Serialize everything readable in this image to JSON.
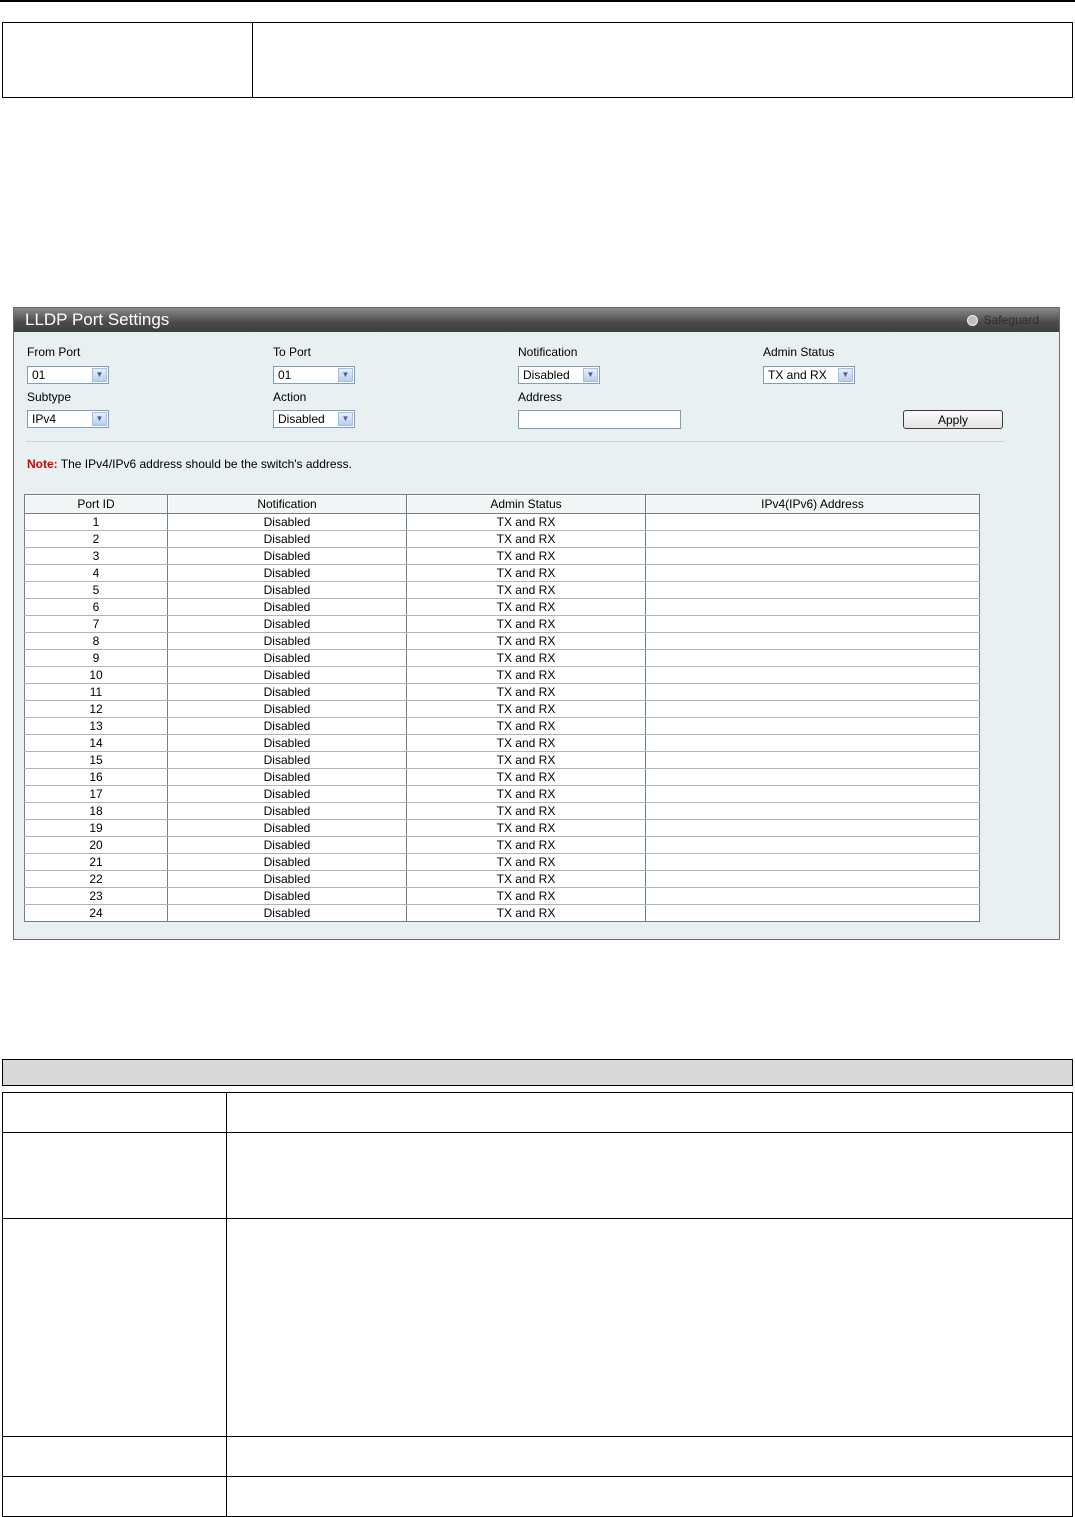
{
  "panel": {
    "title": "LLDP Port Settings",
    "safeguard": "Safeguard"
  },
  "form": {
    "from_port": {
      "label": "From Port",
      "value": "01"
    },
    "to_port": {
      "label": "To Port",
      "value": "01"
    },
    "notification": {
      "label": "Notification",
      "value": "Disabled"
    },
    "admin_status": {
      "label": "Admin Status",
      "value": "TX and RX"
    },
    "subtype": {
      "label": "Subtype",
      "value": "IPv4"
    },
    "action": {
      "label": "Action",
      "value": "Disabled"
    },
    "address": {
      "label": "Address",
      "value": ""
    },
    "apply_label": "Apply"
  },
  "note": {
    "prefix": "Note:",
    "text": " The IPv4/IPv6 address should be the switch's address."
  },
  "table": {
    "headers": [
      "Port ID",
      "Notification",
      "Admin Status",
      "IPv4(IPv6) Address"
    ],
    "rows": [
      [
        "1",
        "Disabled",
        "TX and RX",
        ""
      ],
      [
        "2",
        "Disabled",
        "TX and RX",
        ""
      ],
      [
        "3",
        "Disabled",
        "TX and RX",
        ""
      ],
      [
        "4",
        "Disabled",
        "TX and RX",
        ""
      ],
      [
        "5",
        "Disabled",
        "TX and RX",
        ""
      ],
      [
        "6",
        "Disabled",
        "TX and RX",
        ""
      ],
      [
        "7",
        "Disabled",
        "TX and RX",
        ""
      ],
      [
        "8",
        "Disabled",
        "TX and RX",
        ""
      ],
      [
        "9",
        "Disabled",
        "TX and RX",
        ""
      ],
      [
        "10",
        "Disabled",
        "TX and RX",
        ""
      ],
      [
        "11",
        "Disabled",
        "TX and RX",
        ""
      ],
      [
        "12",
        "Disabled",
        "TX and RX",
        ""
      ],
      [
        "13",
        "Disabled",
        "TX and RX",
        ""
      ],
      [
        "14",
        "Disabled",
        "TX and RX",
        ""
      ],
      [
        "15",
        "Disabled",
        "TX and RX",
        ""
      ],
      [
        "16",
        "Disabled",
        "TX and RX",
        ""
      ],
      [
        "17",
        "Disabled",
        "TX and RX",
        ""
      ],
      [
        "18",
        "Disabled",
        "TX and RX",
        ""
      ],
      [
        "19",
        "Disabled",
        "TX and RX",
        ""
      ],
      [
        "20",
        "Disabled",
        "TX and RX",
        ""
      ],
      [
        "21",
        "Disabled",
        "TX and RX",
        ""
      ],
      [
        "22",
        "Disabled",
        "TX and RX",
        ""
      ],
      [
        "23",
        "Disabled",
        "TX and RX",
        ""
      ],
      [
        "24",
        "Disabled",
        "TX and RX",
        ""
      ]
    ]
  },
  "icons": {
    "dropdown": "chevron-down-icon",
    "status_led": "status-led-icon"
  },
  "colors": {
    "header_dark": "#4b4b4b",
    "panel_bg": "#e9f0f2",
    "note_red": "#d40000"
  }
}
